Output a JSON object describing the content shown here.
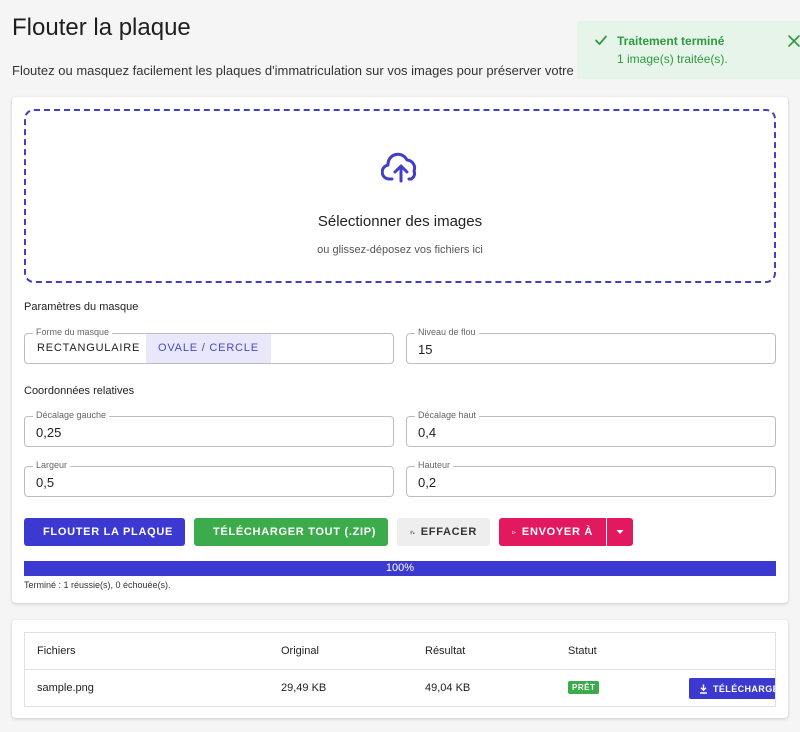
{
  "header": {
    "title": "Flouter la plaque",
    "subtitle": "Floutez ou masquez facilement les plaques d'immatriculation sur vos images pour préserver votre vie"
  },
  "toast": {
    "title": "Traitement terminé",
    "message": "1 image(s) traitée(s).",
    "icon": "check-icon",
    "close_icon": "close-icon"
  },
  "dropzone": {
    "title": "Sélectionner des images",
    "subtitle": "ou glissez-déposez vos fichiers ici",
    "icon": "cloud-upload-icon"
  },
  "mask_settings": {
    "section_label": "Paramètres du masque",
    "shape_label": "Forme du masque",
    "shape_options": [
      "RECTANGULAIRE",
      "OVALE / CERCLE"
    ],
    "shape_selected": "OVALE / CERCLE",
    "blur_label": "Niveau de flou",
    "blur_value": "15"
  },
  "coords": {
    "section_label": "Coordonnées relatives",
    "left_label": "Décalage gauche",
    "left_value": "0,25",
    "top_label": "Décalage haut",
    "top_value": "0,4",
    "width_label": "Largeur",
    "width_value": "0,5",
    "height_label": "Hauteur",
    "height_value": "0,2"
  },
  "actions": {
    "blur_label": "FLOUTER LA PLAQUE",
    "zip_label": "TÉLÉCHARGER TOUT (.ZIP)",
    "clear_label": "EFFACER",
    "send_label": "ENVOYER À"
  },
  "progress": {
    "value": 1.0,
    "label": "100%",
    "status_text": "Terminé : 1 réussie(s), 0 échouée(s)."
  },
  "files_table": {
    "headers": [
      "Fichiers",
      "Original",
      "Résultat",
      "Statut"
    ],
    "rows": [
      {
        "name": "sample.png",
        "original": "29,49 KB",
        "result": "49,04 KB",
        "status": "PRÊT",
        "action": "TÉLÉCHARGER"
      }
    ]
  },
  "colors": {
    "primary": "#3b39d0",
    "success": "#3cab4b",
    "accent": "#e2195e",
    "toast_bg": "#e6f4ea"
  }
}
